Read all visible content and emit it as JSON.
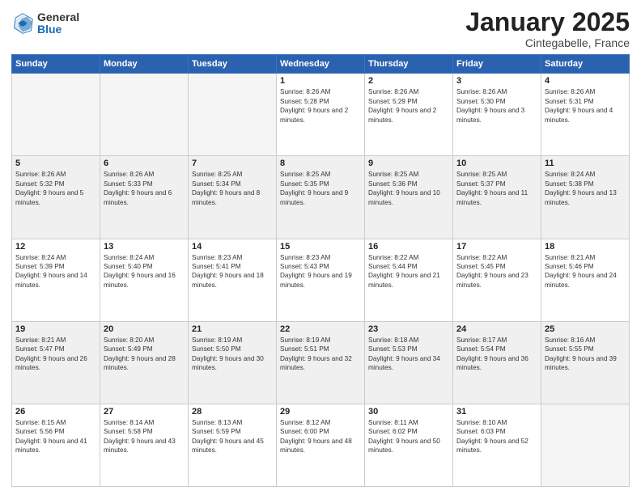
{
  "header": {
    "logo_general": "General",
    "logo_blue": "Blue",
    "month_title": "January 2025",
    "location": "Cintegabelle, France"
  },
  "days_of_week": [
    "Sunday",
    "Monday",
    "Tuesday",
    "Wednesday",
    "Thursday",
    "Friday",
    "Saturday"
  ],
  "weeks": [
    [
      {
        "day": "",
        "info": ""
      },
      {
        "day": "",
        "info": ""
      },
      {
        "day": "",
        "info": ""
      },
      {
        "day": "1",
        "sunrise": "Sunrise: 8:26 AM",
        "sunset": "Sunset: 5:28 PM",
        "daylight": "Daylight: 9 hours and 2 minutes."
      },
      {
        "day": "2",
        "sunrise": "Sunrise: 8:26 AM",
        "sunset": "Sunset: 5:29 PM",
        "daylight": "Daylight: 9 hours and 2 minutes."
      },
      {
        "day": "3",
        "sunrise": "Sunrise: 8:26 AM",
        "sunset": "Sunset: 5:30 PM",
        "daylight": "Daylight: 9 hours and 3 minutes."
      },
      {
        "day": "4",
        "sunrise": "Sunrise: 8:26 AM",
        "sunset": "Sunset: 5:31 PM",
        "daylight": "Daylight: 9 hours and 4 minutes."
      }
    ],
    [
      {
        "day": "5",
        "sunrise": "Sunrise: 8:26 AM",
        "sunset": "Sunset: 5:32 PM",
        "daylight": "Daylight: 9 hours and 5 minutes."
      },
      {
        "day": "6",
        "sunrise": "Sunrise: 8:26 AM",
        "sunset": "Sunset: 5:33 PM",
        "daylight": "Daylight: 9 hours and 6 minutes."
      },
      {
        "day": "7",
        "sunrise": "Sunrise: 8:25 AM",
        "sunset": "Sunset: 5:34 PM",
        "daylight": "Daylight: 9 hours and 8 minutes."
      },
      {
        "day": "8",
        "sunrise": "Sunrise: 8:25 AM",
        "sunset": "Sunset: 5:35 PM",
        "daylight": "Daylight: 9 hours and 9 minutes."
      },
      {
        "day": "9",
        "sunrise": "Sunrise: 8:25 AM",
        "sunset": "Sunset: 5:36 PM",
        "daylight": "Daylight: 9 hours and 10 minutes."
      },
      {
        "day": "10",
        "sunrise": "Sunrise: 8:25 AM",
        "sunset": "Sunset: 5:37 PM",
        "daylight": "Daylight: 9 hours and 11 minutes."
      },
      {
        "day": "11",
        "sunrise": "Sunrise: 8:24 AM",
        "sunset": "Sunset: 5:38 PM",
        "daylight": "Daylight: 9 hours and 13 minutes."
      }
    ],
    [
      {
        "day": "12",
        "sunrise": "Sunrise: 8:24 AM",
        "sunset": "Sunset: 5:39 PM",
        "daylight": "Daylight: 9 hours and 14 minutes."
      },
      {
        "day": "13",
        "sunrise": "Sunrise: 8:24 AM",
        "sunset": "Sunset: 5:40 PM",
        "daylight": "Daylight: 9 hours and 16 minutes."
      },
      {
        "day": "14",
        "sunrise": "Sunrise: 8:23 AM",
        "sunset": "Sunset: 5:41 PM",
        "daylight": "Daylight: 9 hours and 18 minutes."
      },
      {
        "day": "15",
        "sunrise": "Sunrise: 8:23 AM",
        "sunset": "Sunset: 5:43 PM",
        "daylight": "Daylight: 9 hours and 19 minutes."
      },
      {
        "day": "16",
        "sunrise": "Sunrise: 8:22 AM",
        "sunset": "Sunset: 5:44 PM",
        "daylight": "Daylight: 9 hours and 21 minutes."
      },
      {
        "day": "17",
        "sunrise": "Sunrise: 8:22 AM",
        "sunset": "Sunset: 5:45 PM",
        "daylight": "Daylight: 9 hours and 23 minutes."
      },
      {
        "day": "18",
        "sunrise": "Sunrise: 8:21 AM",
        "sunset": "Sunset: 5:46 PM",
        "daylight": "Daylight: 9 hours and 24 minutes."
      }
    ],
    [
      {
        "day": "19",
        "sunrise": "Sunrise: 8:21 AM",
        "sunset": "Sunset: 5:47 PM",
        "daylight": "Daylight: 9 hours and 26 minutes."
      },
      {
        "day": "20",
        "sunrise": "Sunrise: 8:20 AM",
        "sunset": "Sunset: 5:49 PM",
        "daylight": "Daylight: 9 hours and 28 minutes."
      },
      {
        "day": "21",
        "sunrise": "Sunrise: 8:19 AM",
        "sunset": "Sunset: 5:50 PM",
        "daylight": "Daylight: 9 hours and 30 minutes."
      },
      {
        "day": "22",
        "sunrise": "Sunrise: 8:19 AM",
        "sunset": "Sunset: 5:51 PM",
        "daylight": "Daylight: 9 hours and 32 minutes."
      },
      {
        "day": "23",
        "sunrise": "Sunrise: 8:18 AM",
        "sunset": "Sunset: 5:53 PM",
        "daylight": "Daylight: 9 hours and 34 minutes."
      },
      {
        "day": "24",
        "sunrise": "Sunrise: 8:17 AM",
        "sunset": "Sunset: 5:54 PM",
        "daylight": "Daylight: 9 hours and 36 minutes."
      },
      {
        "day": "25",
        "sunrise": "Sunrise: 8:16 AM",
        "sunset": "Sunset: 5:55 PM",
        "daylight": "Daylight: 9 hours and 39 minutes."
      }
    ],
    [
      {
        "day": "26",
        "sunrise": "Sunrise: 8:15 AM",
        "sunset": "Sunset: 5:56 PM",
        "daylight": "Daylight: 9 hours and 41 minutes."
      },
      {
        "day": "27",
        "sunrise": "Sunrise: 8:14 AM",
        "sunset": "Sunset: 5:58 PM",
        "daylight": "Daylight: 9 hours and 43 minutes."
      },
      {
        "day": "28",
        "sunrise": "Sunrise: 8:13 AM",
        "sunset": "Sunset: 5:59 PM",
        "daylight": "Daylight: 9 hours and 45 minutes."
      },
      {
        "day": "29",
        "sunrise": "Sunrise: 8:12 AM",
        "sunset": "Sunset: 6:00 PM",
        "daylight": "Daylight: 9 hours and 48 minutes."
      },
      {
        "day": "30",
        "sunrise": "Sunrise: 8:11 AM",
        "sunset": "Sunset: 6:02 PM",
        "daylight": "Daylight: 9 hours and 50 minutes."
      },
      {
        "day": "31",
        "sunrise": "Sunrise: 8:10 AM",
        "sunset": "Sunset: 6:03 PM",
        "daylight": "Daylight: 9 hours and 52 minutes."
      },
      {
        "day": "",
        "info": ""
      }
    ]
  ]
}
